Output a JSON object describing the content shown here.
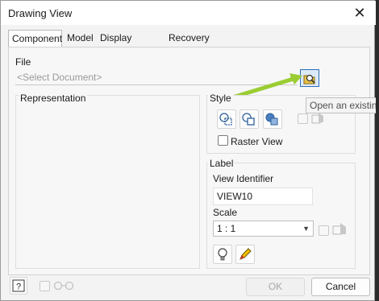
{
  "dialog": {
    "title": "Drawing View",
    "close_glyph": "✕"
  },
  "tabs": [
    {
      "label": "Component",
      "active": true
    },
    {
      "label": "Model",
      "active": false
    },
    {
      "label": "Display Options",
      "active": false
    },
    {
      "label": "Recovery Options",
      "active": false
    }
  ],
  "file": {
    "label": "File",
    "placeholder": "<Select Document>"
  },
  "representation": {
    "label": "Representation"
  },
  "style": {
    "label": "Style",
    "icons": [
      "hidden-line-icon",
      "hidden-line-removed-icon",
      "shaded-icon",
      "style-from-base-icon"
    ],
    "raster_view_label": "Raster View",
    "raster_view_checked": false
  },
  "label_group": {
    "label": "Label",
    "view_identifier_label": "View Identifier",
    "view_identifier_value": "VIEW10",
    "scale_label": "Scale",
    "scale_value": "1 : 1"
  },
  "tooltip": {
    "text": "Open an existing"
  },
  "footer": {
    "ok_label": "OK",
    "cancel_label": "Cancel",
    "ok_enabled": false
  },
  "colors": {
    "accent": "#2d6fb8",
    "arrow": "#9acd32"
  }
}
